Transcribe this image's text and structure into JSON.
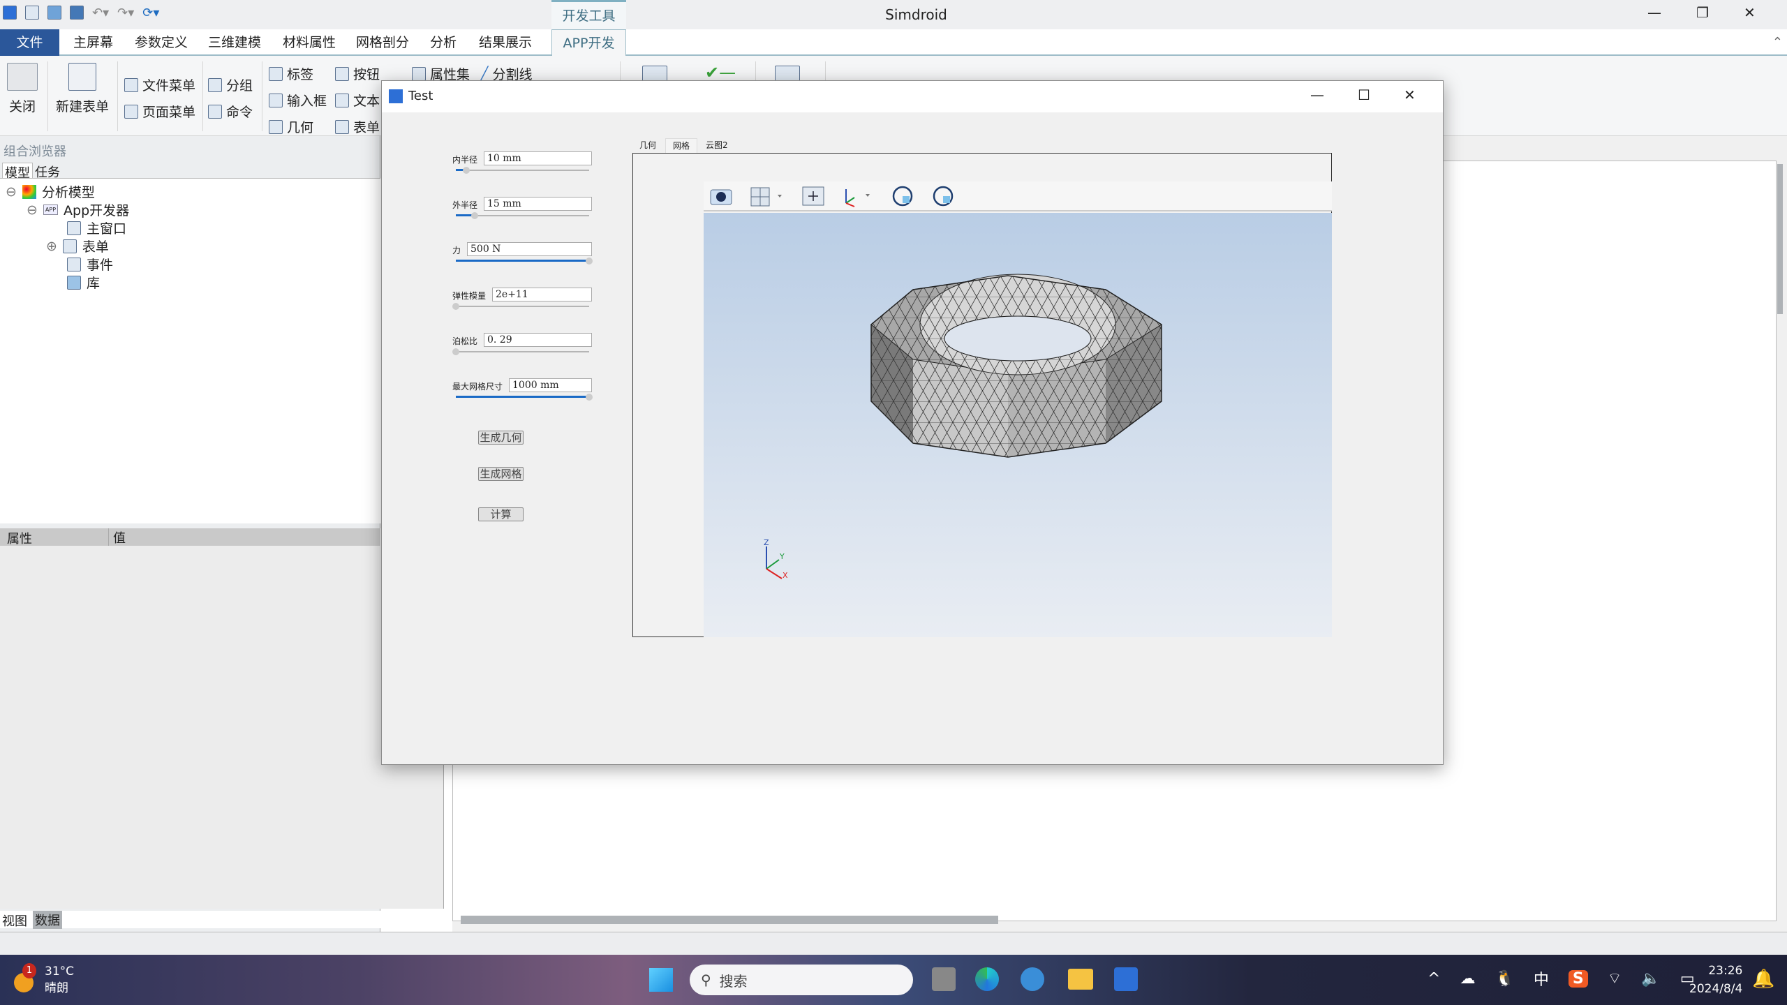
{
  "app": {
    "title": "Simdroid",
    "context_tab": "开发工具"
  },
  "menu": [
    "文件",
    "主屏幕",
    "参数定义",
    "三维建模",
    "材料属性",
    "网格剖分",
    "分析",
    "结果展示",
    "APP开发器"
  ],
  "ribbon": {
    "close": "关闭",
    "new_form": "新建表单",
    "file_menu": "文件菜单",
    "page_menu": "页面菜单",
    "group": "分组",
    "command": "命令",
    "label": "标签",
    "input": "输入框",
    "geometry": "几何",
    "button": "按钮",
    "text": "文本",
    "form": "表单",
    "property_set": "属性集",
    "divider": "分割线"
  },
  "left_panel": {
    "title": "组合浏览器",
    "tabs": [
      "模型",
      "任务"
    ],
    "tree": [
      {
        "label": "分析模型",
        "expanded": true
      },
      {
        "label": "App开发器",
        "expanded": true
      },
      {
        "label": "主窗口"
      },
      {
        "label": "表单",
        "expanded": false
      },
      {
        "label": "事件"
      },
      {
        "label": "库"
      }
    ],
    "prop_headers": [
      "属性",
      "值"
    ],
    "bottom_tabs": [
      "视图",
      "数据"
    ]
  },
  "dialog": {
    "title": "Test",
    "fields": [
      {
        "label": "内半径",
        "value": "10  mm",
        "slider": 0.08
      },
      {
        "label": "外半径",
        "value": "15  mm",
        "slider": 0.14
      },
      {
        "label": "力",
        "value": "500  N",
        "slider": 1.0
      },
      {
        "label": "弹性模量",
        "value": "2e+11",
        "slider": 0.0
      },
      {
        "label": "泊松比",
        "value": "0. 29",
        "slider": 0.0
      },
      {
        "label": "最大网格尺寸",
        "value": "1000  mm",
        "slider": 1.0
      }
    ],
    "buttons": [
      "生成几何",
      "生成网格",
      "计算"
    ],
    "view_tabs": [
      "几何",
      "网格",
      "云图2"
    ],
    "active_view_tab": "网格",
    "axes": {
      "z": "Z",
      "y": "Y",
      "x": "X"
    },
    "toolbar_icons": [
      "camera-icon",
      "view-cube-icon",
      "fit-view-icon",
      "axes-orientation-icon",
      "rotate-cw-icon",
      "rotate-ccw-icon"
    ]
  },
  "taskbar": {
    "weather_temp": "31°C",
    "weather_desc": "晴朗",
    "weather_badge": "1",
    "search": "搜索",
    "ime": "中",
    "time": "23:26",
    "date": "2024/8/4"
  },
  "colors": {
    "accent": "#2b579a",
    "viewer_top": "#b9cde5",
    "viewer_bottom": "#e9edf3"
  }
}
